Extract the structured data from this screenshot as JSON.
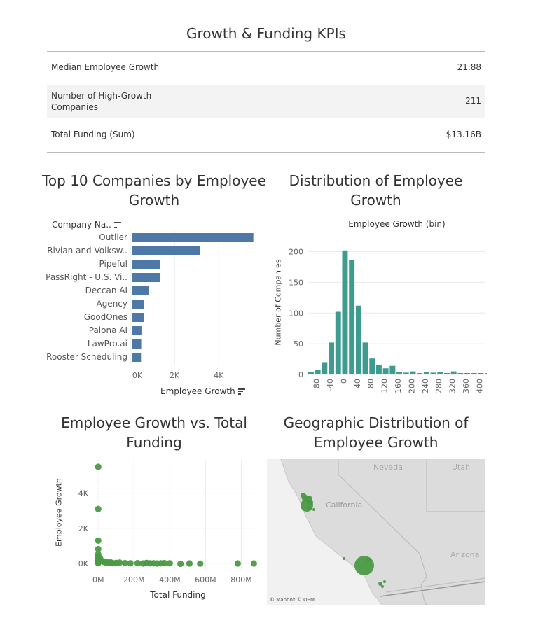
{
  "kpi": {
    "title": "Growth & Funding KPIs",
    "rows": [
      {
        "label": "Median Employee Growth",
        "value": "21.88"
      },
      {
        "label_line1": "Number of High-Growth",
        "label_line2": "Companies",
        "value": "211"
      },
      {
        "label": "Total Funding (Sum)",
        "value": "$13.16B"
      }
    ]
  },
  "top10": {
    "title_line1": "Top 10 Companies by Employee",
    "title_line2": "Growth",
    "column_header": "Company Na..",
    "xlabel": "Employee Growth",
    "tick_labels": [
      "0K",
      "2K",
      "4K"
    ]
  },
  "histogram": {
    "title_line1": "Distribution of Employee",
    "title_line2": "Growth",
    "header": "Employee Growth (bin)",
    "ylabel": "Number of Companies"
  },
  "scatter": {
    "title_line1": "Employee Growth vs. Total",
    "title_line2": "Funding",
    "xlabel": "Total Funding",
    "ylabel": "Employee Growth"
  },
  "map": {
    "title_line1": "Geographic Distribution of",
    "title_line2": "Employee Growth",
    "state_labels": [
      "Nevada",
      "Utah",
      "California",
      "Arizona"
    ],
    "attribution": "© Mapbox © OSM",
    "colors": {
      "land": "#dcdcdc",
      "water": "#f0f0f0",
      "marks": "#4a9a45"
    }
  },
  "chart_data": [
    {
      "type": "bar",
      "orientation": "horizontal",
      "title": "Top 10 Companies by Employee Growth",
      "categories": [
        "Outlier",
        "Rivian and Volksw..",
        "Pipeful",
        "PassRight - U.S. Vi..",
        "Deccan AI",
        "Agency",
        "GoodOnes",
        "Palona AI",
        "LawPro.ai",
        "Rooster Scheduling"
      ],
      "values": [
        5500,
        3100,
        1280,
        1280,
        780,
        570,
        560,
        440,
        430,
        420
      ],
      "xlabel": "Employee Growth",
      "xlim": [
        0,
        5700
      ],
      "xticks": [
        0,
        2000,
        4000
      ],
      "color": "#4e79a7",
      "grid": true
    },
    {
      "type": "bar",
      "title": "Distribution of Employee Growth",
      "categories": [
        "-90",
        "-80",
        "-70",
        "-60",
        "-50",
        "-40",
        "-30",
        "-20",
        "-10",
        "0",
        "10",
        "20",
        "30",
        "40",
        "50",
        "60",
        "70",
        "80",
        "90",
        "100",
        "110",
        "120",
        "130",
        "140",
        "150",
        "160",
        "170",
        "180",
        "190",
        "200",
        "210",
        "220",
        "230",
        "240",
        "250",
        "260",
        "270",
        "280",
        "290",
        "300",
        "310",
        "320",
        "330",
        "340",
        "350",
        "360",
        "370",
        "380",
        "390",
        "400",
        "410"
      ],
      "tick_labels": [
        "-80",
        "-40",
        "0",
        "40",
        "80",
        "120",
        "160",
        "200",
        "240",
        "280",
        "320",
        "360",
        "400"
      ],
      "values": [
        4,
        8,
        20,
        52,
        102,
        202,
        186,
        112,
        52,
        26,
        16,
        10,
        14,
        4,
        3,
        5,
        2,
        4,
        3,
        4,
        2,
        5,
        1,
        1,
        2,
        2
      ],
      "value_bins": [
        "-90",
        "-80",
        "-70",
        "-60",
        "-50",
        "-40",
        "-30",
        "-20",
        "-10",
        "0",
        "10",
        "20",
        "30",
        "40",
        "50",
        "60",
        "70",
        "80",
        "90",
        "100",
        "110",
        "120",
        "130",
        "140",
        "150",
        "160"
      ],
      "xlabel": "Employee Growth (bin)",
      "ylabel": "Number of Companies",
      "ylim": [
        0,
        210
      ],
      "yticks": [
        0,
        50,
        100,
        150,
        200
      ],
      "color": "#3d9b8f",
      "grid": true
    },
    {
      "type": "scatter",
      "title": "Employee Growth vs. Total Funding",
      "xlabel": "Total Funding",
      "ylabel": "Employee Growth",
      "xlim": [
        -40000000,
        900000000
      ],
      "ylim": [
        -400,
        5900
      ],
      "xticks": [
        0,
        200000000,
        400000000,
        600000000,
        800000000
      ],
      "xtick_labels": [
        "0M",
        "200M",
        "400M",
        "600M",
        "800M"
      ],
      "yticks": [
        0,
        2000,
        4000
      ],
      "ytick_labels": [
        "0K",
        "2K",
        "4K"
      ],
      "points": [
        [
          0,
          5500
        ],
        [
          0,
          3100
        ],
        [
          0,
          1300
        ],
        [
          0,
          820
        ],
        [
          0,
          520
        ],
        [
          0,
          400
        ],
        [
          0,
          300
        ],
        [
          0,
          200
        ],
        [
          0,
          120
        ],
        [
          0,
          60
        ],
        [
          0,
          20
        ],
        [
          10000000,
          300
        ],
        [
          20000000,
          150
        ],
        [
          30000000,
          100
        ],
        [
          40000000,
          50
        ],
        [
          50000000,
          80
        ],
        [
          60000000,
          30
        ],
        [
          70000000,
          60
        ],
        [
          80000000,
          20
        ],
        [
          100000000,
          30
        ],
        [
          120000000,
          50
        ],
        [
          150000000,
          20
        ],
        [
          180000000,
          10
        ],
        [
          220000000,
          20
        ],
        [
          250000000,
          0
        ],
        [
          270000000,
          30
        ],
        [
          290000000,
          10
        ],
        [
          310000000,
          10
        ],
        [
          330000000,
          0
        ],
        [
          350000000,
          10
        ],
        [
          370000000,
          20
        ],
        [
          400000000,
          10
        ],
        [
          460000000,
          -20
        ],
        [
          510000000,
          0
        ],
        [
          570000000,
          -10
        ],
        [
          780000000,
          0
        ],
        [
          870000000,
          0
        ]
      ],
      "color": "#4a9a45",
      "grid": true
    }
  ]
}
